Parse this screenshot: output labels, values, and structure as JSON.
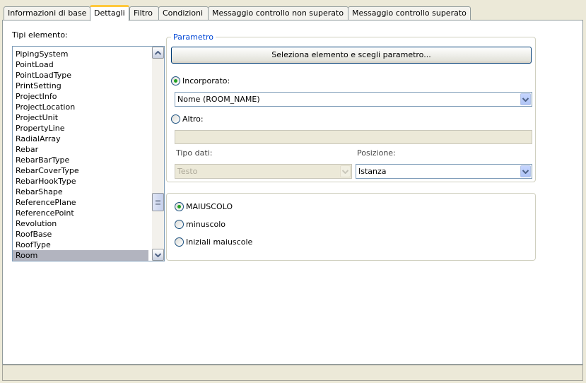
{
  "tabs": [
    {
      "label": "Informazioni di base",
      "active": false
    },
    {
      "label": "Dettagli",
      "active": true
    },
    {
      "label": "Filtro",
      "active": false
    },
    {
      "label": "Condizioni",
      "active": false
    },
    {
      "label": "Messaggio controllo non superato",
      "active": false
    },
    {
      "label": "Messaggio controllo superato",
      "active": false
    }
  ],
  "element_types": {
    "label": "Tipi elemento:",
    "items": [
      "PipingSystem",
      "PointLoad",
      "PointLoadType",
      "PrintSetting",
      "ProjectInfo",
      "ProjectLocation",
      "ProjectUnit",
      "PropertyLine",
      "RadialArray",
      "Rebar",
      "RebarBarType",
      "RebarCoverType",
      "RebarHookType",
      "RebarShape",
      "ReferencePlane",
      "ReferencePoint",
      "Revolution",
      "RoofBase",
      "RoofType",
      "Room"
    ],
    "selected": "Room"
  },
  "parameter": {
    "legend": "Parametro",
    "select_button": "Seleziona elemento e scegli parametro...",
    "builtin_label": "Incorporato:",
    "builtin_checked": true,
    "builtin_value": "Nome (ROOM_NAME)",
    "other_label": "Altro:",
    "other_checked": false,
    "other_value": "",
    "data_type_label": "Tipo dati:",
    "data_type_value": "Testo",
    "position_label": "Posizione:",
    "position_value": "Istanza"
  },
  "case_options": {
    "selected": "MAIUSCOLO",
    "options": [
      {
        "label": "MAIUSCOLO",
        "checked": true
      },
      {
        "label": "minuscolo",
        "checked": false
      },
      {
        "label": "Iniziali maiuscole",
        "checked": false
      }
    ]
  },
  "colors": {
    "tab_highlight": "#ffc83c",
    "legend": "#0046d5",
    "radio_dot": "#21a121",
    "selection": "#b2b4bf"
  }
}
